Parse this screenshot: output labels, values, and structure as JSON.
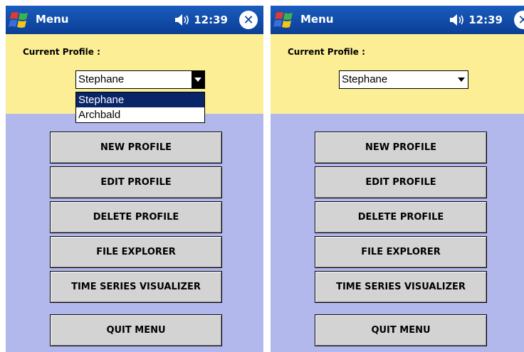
{
  "screens": [
    {
      "title": "Menu",
      "time": "12:39",
      "profile_label": "Current Profile :",
      "selected_profile": "Stephane",
      "dropdown_open": true,
      "dropdown_options": [
        "Stephane",
        "Archbald"
      ],
      "buttons": [
        "NEW PROFILE",
        "EDIT PROFILE",
        "DELETE PROFILE",
        "FILE EXPLORER",
        "TIME SERIES VISUALIZER",
        "QUIT MENU"
      ]
    },
    {
      "title": "Menu",
      "time": "12:39",
      "profile_label": "Current Profile :",
      "selected_profile": "Stephane",
      "dropdown_open": false,
      "buttons": [
        "NEW PROFILE",
        "EDIT PROFILE",
        "DELETE PROFILE",
        "FILE EXPLORER",
        "TIME SERIES VISUALIZER",
        "QUIT MENU"
      ]
    }
  ],
  "icons": {
    "start": "windows-flag-icon",
    "volume": "speaker-icon",
    "close": "close-icon",
    "dropdown": "chevron-down-icon"
  },
  "colors": {
    "titlebar": "#0a3e96",
    "profile_panel": "#fbee94",
    "body": "#b3b8ec",
    "button": "#d3d3d3",
    "selection": "#0a246a"
  }
}
